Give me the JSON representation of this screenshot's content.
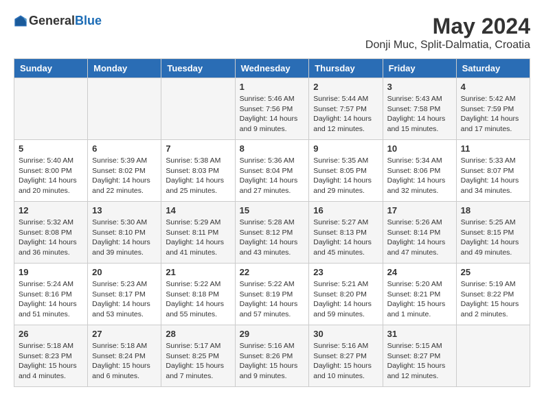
{
  "header": {
    "logo": {
      "general": "General",
      "blue": "Blue"
    },
    "title": "May 2024",
    "location": "Donji Muc, Split-Dalmatia, Croatia"
  },
  "days_of_week": [
    "Sunday",
    "Monday",
    "Tuesday",
    "Wednesday",
    "Thursday",
    "Friday",
    "Saturday"
  ],
  "weeks": [
    {
      "days": [
        {
          "num": "",
          "sunrise": "",
          "sunset": "",
          "daylight": ""
        },
        {
          "num": "",
          "sunrise": "",
          "sunset": "",
          "daylight": ""
        },
        {
          "num": "",
          "sunrise": "",
          "sunset": "",
          "daylight": ""
        },
        {
          "num": "1",
          "sunrise": "Sunrise: 5:46 AM",
          "sunset": "Sunset: 7:56 PM",
          "daylight": "Daylight: 14 hours and 9 minutes."
        },
        {
          "num": "2",
          "sunrise": "Sunrise: 5:44 AM",
          "sunset": "Sunset: 7:57 PM",
          "daylight": "Daylight: 14 hours and 12 minutes."
        },
        {
          "num": "3",
          "sunrise": "Sunrise: 5:43 AM",
          "sunset": "Sunset: 7:58 PM",
          "daylight": "Daylight: 14 hours and 15 minutes."
        },
        {
          "num": "4",
          "sunrise": "Sunrise: 5:42 AM",
          "sunset": "Sunset: 7:59 PM",
          "daylight": "Daylight: 14 hours and 17 minutes."
        }
      ]
    },
    {
      "days": [
        {
          "num": "5",
          "sunrise": "Sunrise: 5:40 AM",
          "sunset": "Sunset: 8:00 PM",
          "daylight": "Daylight: 14 hours and 20 minutes."
        },
        {
          "num": "6",
          "sunrise": "Sunrise: 5:39 AM",
          "sunset": "Sunset: 8:02 PM",
          "daylight": "Daylight: 14 hours and 22 minutes."
        },
        {
          "num": "7",
          "sunrise": "Sunrise: 5:38 AM",
          "sunset": "Sunset: 8:03 PM",
          "daylight": "Daylight: 14 hours and 25 minutes."
        },
        {
          "num": "8",
          "sunrise": "Sunrise: 5:36 AM",
          "sunset": "Sunset: 8:04 PM",
          "daylight": "Daylight: 14 hours and 27 minutes."
        },
        {
          "num": "9",
          "sunrise": "Sunrise: 5:35 AM",
          "sunset": "Sunset: 8:05 PM",
          "daylight": "Daylight: 14 hours and 29 minutes."
        },
        {
          "num": "10",
          "sunrise": "Sunrise: 5:34 AM",
          "sunset": "Sunset: 8:06 PM",
          "daylight": "Daylight: 14 hours and 32 minutes."
        },
        {
          "num": "11",
          "sunrise": "Sunrise: 5:33 AM",
          "sunset": "Sunset: 8:07 PM",
          "daylight": "Daylight: 14 hours and 34 minutes."
        }
      ]
    },
    {
      "days": [
        {
          "num": "12",
          "sunrise": "Sunrise: 5:32 AM",
          "sunset": "Sunset: 8:08 PM",
          "daylight": "Daylight: 14 hours and 36 minutes."
        },
        {
          "num": "13",
          "sunrise": "Sunrise: 5:30 AM",
          "sunset": "Sunset: 8:10 PM",
          "daylight": "Daylight: 14 hours and 39 minutes."
        },
        {
          "num": "14",
          "sunrise": "Sunrise: 5:29 AM",
          "sunset": "Sunset: 8:11 PM",
          "daylight": "Daylight: 14 hours and 41 minutes."
        },
        {
          "num": "15",
          "sunrise": "Sunrise: 5:28 AM",
          "sunset": "Sunset: 8:12 PM",
          "daylight": "Daylight: 14 hours and 43 minutes."
        },
        {
          "num": "16",
          "sunrise": "Sunrise: 5:27 AM",
          "sunset": "Sunset: 8:13 PM",
          "daylight": "Daylight: 14 hours and 45 minutes."
        },
        {
          "num": "17",
          "sunrise": "Sunrise: 5:26 AM",
          "sunset": "Sunset: 8:14 PM",
          "daylight": "Daylight: 14 hours and 47 minutes."
        },
        {
          "num": "18",
          "sunrise": "Sunrise: 5:25 AM",
          "sunset": "Sunset: 8:15 PM",
          "daylight": "Daylight: 14 hours and 49 minutes."
        }
      ]
    },
    {
      "days": [
        {
          "num": "19",
          "sunrise": "Sunrise: 5:24 AM",
          "sunset": "Sunset: 8:16 PM",
          "daylight": "Daylight: 14 hours and 51 minutes."
        },
        {
          "num": "20",
          "sunrise": "Sunrise: 5:23 AM",
          "sunset": "Sunset: 8:17 PM",
          "daylight": "Daylight: 14 hours and 53 minutes."
        },
        {
          "num": "21",
          "sunrise": "Sunrise: 5:22 AM",
          "sunset": "Sunset: 8:18 PM",
          "daylight": "Daylight: 14 hours and 55 minutes."
        },
        {
          "num": "22",
          "sunrise": "Sunrise: 5:22 AM",
          "sunset": "Sunset: 8:19 PM",
          "daylight": "Daylight: 14 hours and 57 minutes."
        },
        {
          "num": "23",
          "sunrise": "Sunrise: 5:21 AM",
          "sunset": "Sunset: 8:20 PM",
          "daylight": "Daylight: 14 hours and 59 minutes."
        },
        {
          "num": "24",
          "sunrise": "Sunrise: 5:20 AM",
          "sunset": "Sunset: 8:21 PM",
          "daylight": "Daylight: 15 hours and 1 minute."
        },
        {
          "num": "25",
          "sunrise": "Sunrise: 5:19 AM",
          "sunset": "Sunset: 8:22 PM",
          "daylight": "Daylight: 15 hours and 2 minutes."
        }
      ]
    },
    {
      "days": [
        {
          "num": "26",
          "sunrise": "Sunrise: 5:18 AM",
          "sunset": "Sunset: 8:23 PM",
          "daylight": "Daylight: 15 hours and 4 minutes."
        },
        {
          "num": "27",
          "sunrise": "Sunrise: 5:18 AM",
          "sunset": "Sunset: 8:24 PM",
          "daylight": "Daylight: 15 hours and 6 minutes."
        },
        {
          "num": "28",
          "sunrise": "Sunrise: 5:17 AM",
          "sunset": "Sunset: 8:25 PM",
          "daylight": "Daylight: 15 hours and 7 minutes."
        },
        {
          "num": "29",
          "sunrise": "Sunrise: 5:16 AM",
          "sunset": "Sunset: 8:26 PM",
          "daylight": "Daylight: 15 hours and 9 minutes."
        },
        {
          "num": "30",
          "sunrise": "Sunrise: 5:16 AM",
          "sunset": "Sunset: 8:27 PM",
          "daylight": "Daylight: 15 hours and 10 minutes."
        },
        {
          "num": "31",
          "sunrise": "Sunrise: 5:15 AM",
          "sunset": "Sunset: 8:27 PM",
          "daylight": "Daylight: 15 hours and 12 minutes."
        },
        {
          "num": "",
          "sunrise": "",
          "sunset": "",
          "daylight": ""
        }
      ]
    }
  ]
}
